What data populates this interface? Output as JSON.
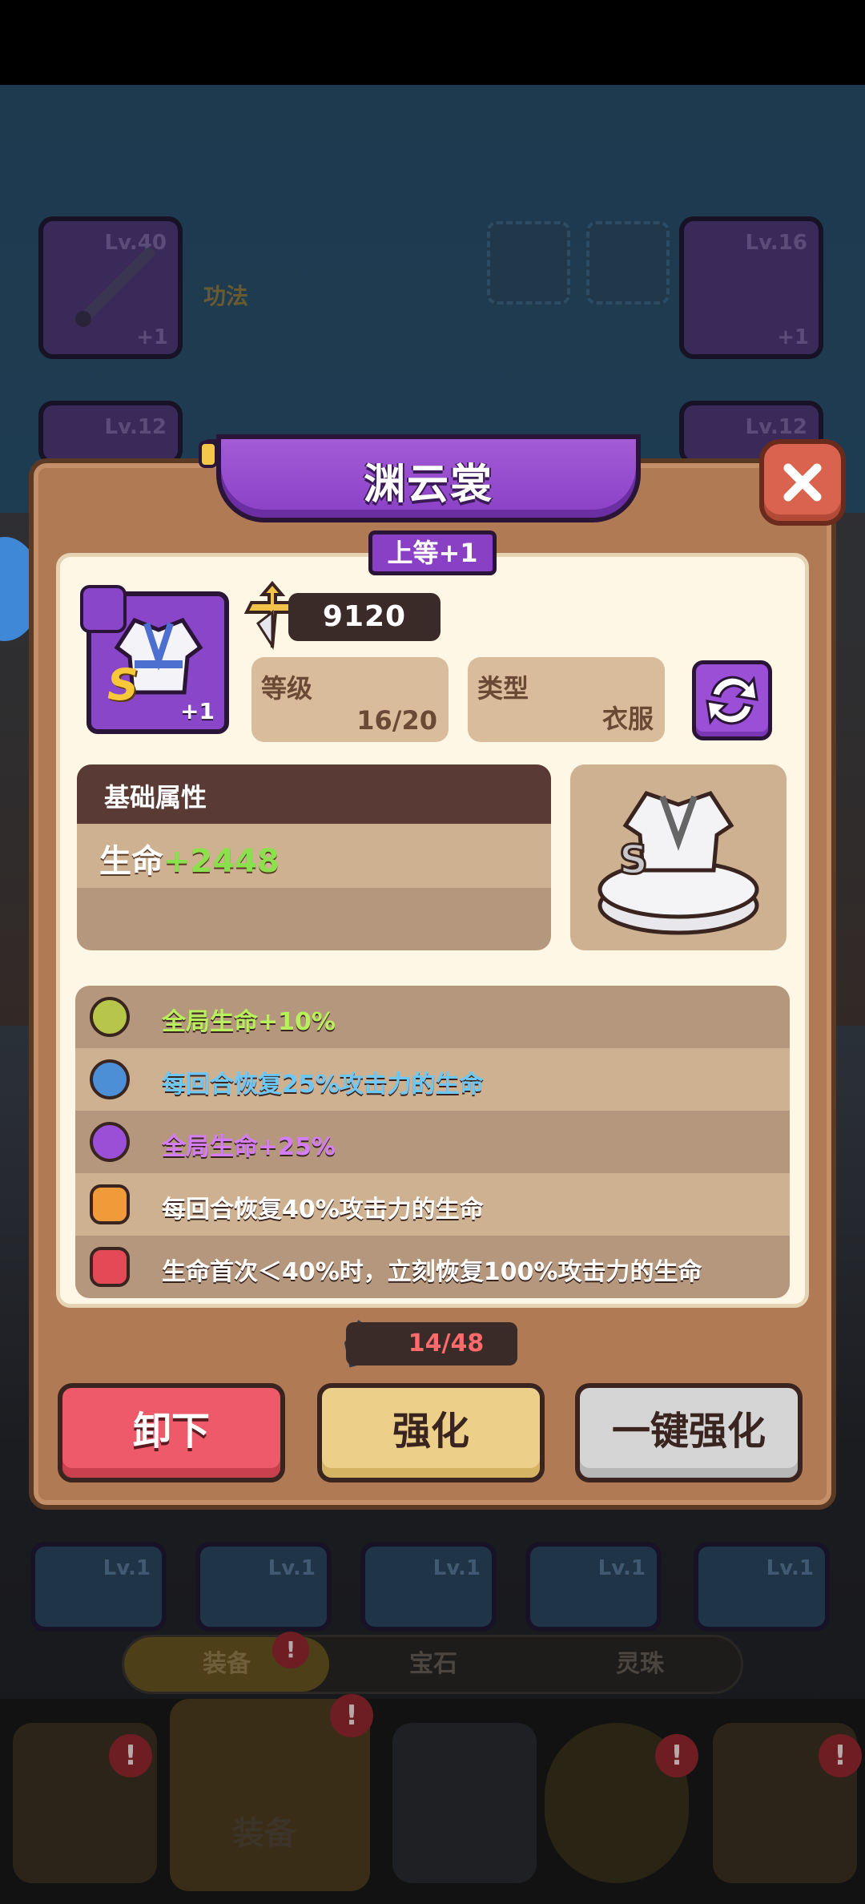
{
  "background": {
    "slots": [
      {
        "level": "Lv.40",
        "plus": "+1"
      },
      {
        "level": "Lv.16",
        "plus": "+1"
      },
      {
        "level": "Lv.12",
        "plus": ""
      },
      {
        "level": "Lv.12",
        "plus": ""
      }
    ],
    "gongfa_label": "功法",
    "bottom_slots": [
      "Lv.1",
      "Lv.1",
      "Lv.1",
      "Lv.1",
      "Lv.1"
    ],
    "tabs": [
      {
        "label": "装备",
        "active": true
      },
      {
        "label": "宝石",
        "active": false
      },
      {
        "label": "灵珠",
        "active": false
      }
    ],
    "dock_label": "装备",
    "badge": "!"
  },
  "dialog": {
    "title": "渊云裳",
    "grade": "上等+1",
    "item": {
      "tier": "S",
      "plus": "+1"
    },
    "power": "9120",
    "level": {
      "label": "等级",
      "value": "16/20"
    },
    "type": {
      "label": "类型",
      "value": "衣服"
    },
    "base_attr": {
      "header": "基础属性",
      "stat_name": "生命",
      "stat_value": "+2448"
    },
    "effects": [
      {
        "text": "全局生命+10%",
        "color": "#b8ef5c",
        "orb": "#b7c64a",
        "icon": "green-orb-icon"
      },
      {
        "text": "每回合恢复25%攻击力的生命",
        "color": "#6ec8f7",
        "orb": "#4c8fd6",
        "icon": "blue-orb-icon"
      },
      {
        "text": "全局生命+25%",
        "color": "#d57cf7",
        "orb": "#9b4fd6",
        "icon": "purple-orb-icon"
      },
      {
        "text": "每回合恢复40%攻击力的生命",
        "color": "#ffffff",
        "orb": "#f09a3a",
        "icon": "orange-lock-icon"
      },
      {
        "text": "生命首次＜40%时，立刻恢复100%攻击力的生命",
        "color": "#ffffff",
        "orb": "#e34a55",
        "icon": "red-lock-icon"
      }
    ],
    "crystals": "14/48",
    "buttons": {
      "remove": "卸下",
      "enhance": "强化",
      "one_key": "一键强化"
    }
  }
}
